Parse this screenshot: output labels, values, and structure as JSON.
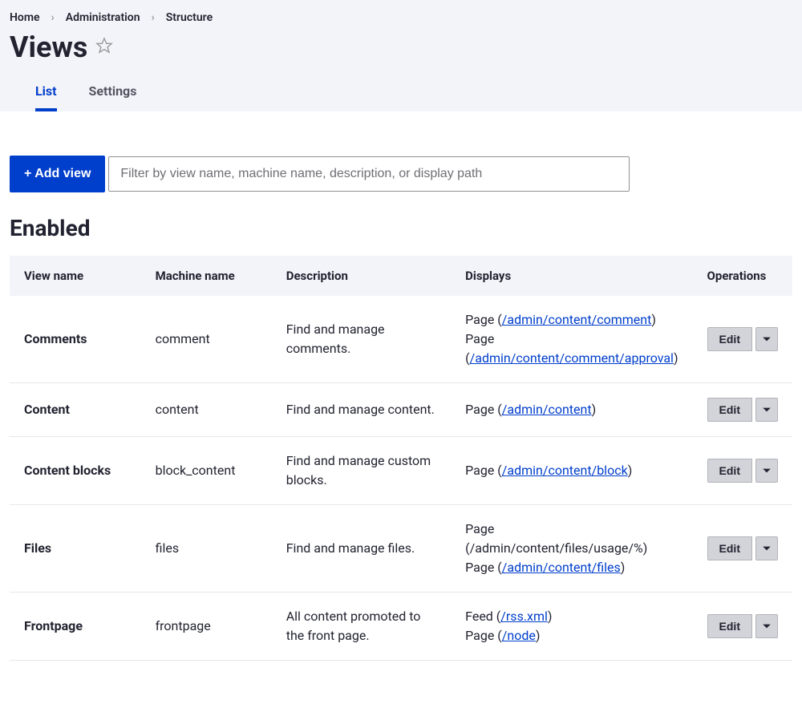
{
  "breadcrumb": [
    "Home",
    "Administration",
    "Structure"
  ],
  "page_title": "Views",
  "tabs": [
    {
      "label": "List",
      "active": true
    },
    {
      "label": "Settings",
      "active": false
    }
  ],
  "add_button_label": "+ Add view",
  "filter_placeholder": "Filter by view name, machine name, description, or display path",
  "section_title": "Enabled",
  "columns": [
    "View name",
    "Machine name",
    "Description",
    "Displays",
    "Operations"
  ],
  "edit_label": "Edit",
  "rows": [
    {
      "name": "Comments",
      "machine": "comment",
      "description": "Find and manage comments.",
      "displays": [
        {
          "prefix": "Page (",
          "link": "/admin/content/comment",
          "link_is_link": true,
          "suffix": ")"
        },
        {
          "prefix": "Page (",
          "link": "/admin/content/comment/approval",
          "link_is_link": true,
          "suffix": ")"
        }
      ]
    },
    {
      "name": "Content",
      "machine": "content",
      "description": "Find and manage content.",
      "displays": [
        {
          "prefix": "Page (",
          "link": "/admin/content",
          "link_is_link": true,
          "suffix": ")"
        }
      ]
    },
    {
      "name": "Content blocks",
      "machine": "block_content",
      "description": "Find and manage custom blocks.",
      "displays": [
        {
          "prefix": "Page (",
          "link": "/admin/content/block",
          "link_is_link": true,
          "suffix": ")"
        }
      ]
    },
    {
      "name": "Files",
      "machine": "files",
      "description": "Find and manage files.",
      "displays": [
        {
          "prefix": "Page (",
          "link": "/admin/content/files/usage/%",
          "link_is_link": false,
          "suffix": ")"
        },
        {
          "prefix": "Page (",
          "link": "/admin/content/files",
          "link_is_link": true,
          "suffix": ")"
        }
      ]
    },
    {
      "name": "Frontpage",
      "machine": "frontpage",
      "description": "All content promoted to the front page.",
      "displays": [
        {
          "prefix": "Feed (",
          "link": "/rss.xml",
          "link_is_link": true,
          "suffix": ")"
        },
        {
          "prefix": "Page (",
          "link": "/node",
          "link_is_link": true,
          "suffix": ")"
        }
      ]
    }
  ]
}
